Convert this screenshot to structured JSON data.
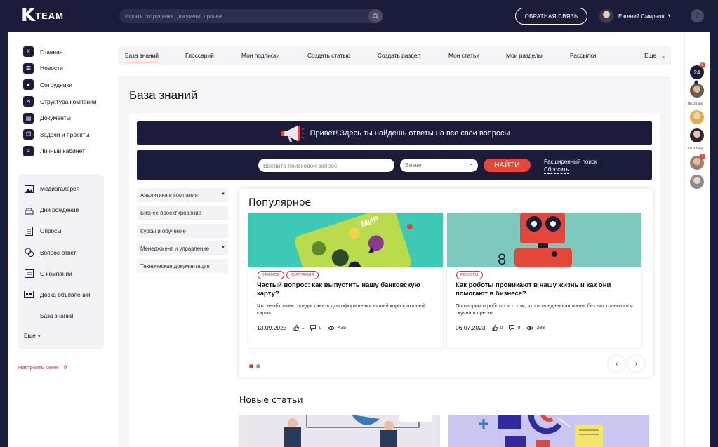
{
  "app": {
    "logo_letter": "K",
    "logo_text": "TEAM"
  },
  "header": {
    "search_placeholder": "Искать сотрудника, документ, прочее...",
    "feedback_label": "ОБРАТНАЯ СВЯЗЬ",
    "user_name": "Евгений Смирнов",
    "help_glyph": "?"
  },
  "sidebar": {
    "primary": [
      {
        "label": "Главная",
        "icon": "logo-icon"
      },
      {
        "label": "Новости",
        "icon": "news-icon"
      },
      {
        "label": "Сотрудники",
        "icon": "employees-icon"
      },
      {
        "label": "Структура компании",
        "icon": "structure-icon"
      },
      {
        "label": "Документы",
        "icon": "document-icon"
      },
      {
        "label": "Задачи и проекты",
        "icon": "tasks-icon"
      },
      {
        "label": "Личный кабинет",
        "icon": "profile-icon"
      }
    ],
    "secondary": [
      {
        "label": "Медиагалерея",
        "icon": "gallery-icon"
      },
      {
        "label": "Дни рождения",
        "icon": "cake-icon"
      },
      {
        "label": "Опросы",
        "icon": "poll-icon"
      },
      {
        "label": "Вопрос-ответ",
        "icon": "qa-icon"
      },
      {
        "label": "О компании",
        "icon": "company-icon"
      },
      {
        "label": "Доска объявлений",
        "icon": "board-icon"
      },
      {
        "label": "База знаний",
        "icon": ""
      }
    ],
    "more_label": "Еще",
    "customize_label": "Настроить меню"
  },
  "tabs": {
    "items": [
      "База знаний",
      "Глоссарий",
      "Мои подписки",
      "Создать статью",
      "Создать раздел",
      "Мои статьи",
      "Мои разделы",
      "Рассылки"
    ],
    "more_label": "Еще"
  },
  "page": {
    "title": "База знаний",
    "banner_text": "Привет! Здесь ты найдешь ответы на все свои вопросы",
    "search_placeholder": "Введите поисковой запрос",
    "scope_value": "Везде",
    "find_label": "НАЙТИ",
    "advanced_label": "Расширенный поиск",
    "reset_label": "Сбросить"
  },
  "categories": [
    {
      "label": "Аналитика в компании",
      "expandable": true
    },
    {
      "label": "Бизнес-проектирование",
      "expandable": false
    },
    {
      "label": "Курсы и обучение",
      "expandable": false
    },
    {
      "label": "Менеджмент и управление",
      "expandable": true
    },
    {
      "label": "Техническая документация",
      "expandable": false
    }
  ],
  "popular": {
    "title": "Популярное",
    "articles": [
      {
        "tags": [
          "ВАЖНОЕ",
          "КОМПАНИЯ"
        ],
        "title": "Частый вопрос: как выпустить нашу банковскую карту?",
        "description": "Что необходимо предоставить для оформления нашей корпоративной карты",
        "date": "13.09.2023",
        "likes": "1",
        "comments": "0",
        "views": "435",
        "image_text": "МИР"
      },
      {
        "tags": [
          "РОБОТЫ"
        ],
        "title": "Как роботы проникают в нашу жизнь и как они помогают в бизнесе?",
        "description": "Поговорим о роботах и о том, что повседневная жизнь без них становится скучна и пресна",
        "date": "06.07.2023",
        "likes": "0",
        "comments": "0",
        "views": "388",
        "image_text": ""
      }
    ],
    "prev_glyph": "‹",
    "next_glyph": "›"
  },
  "new_articles": {
    "title": "Новые статьи"
  },
  "right_panel": {
    "calendar_day": "24",
    "calendar_badge": "6",
    "date1": "Пн, 26 апр",
    "date2": "Сб, 17 апр",
    "avatar_badge": "1"
  },
  "colors": {
    "navy": "#1b1b3a",
    "accent": "#e2473a",
    "panel": "#f3f3f5"
  }
}
